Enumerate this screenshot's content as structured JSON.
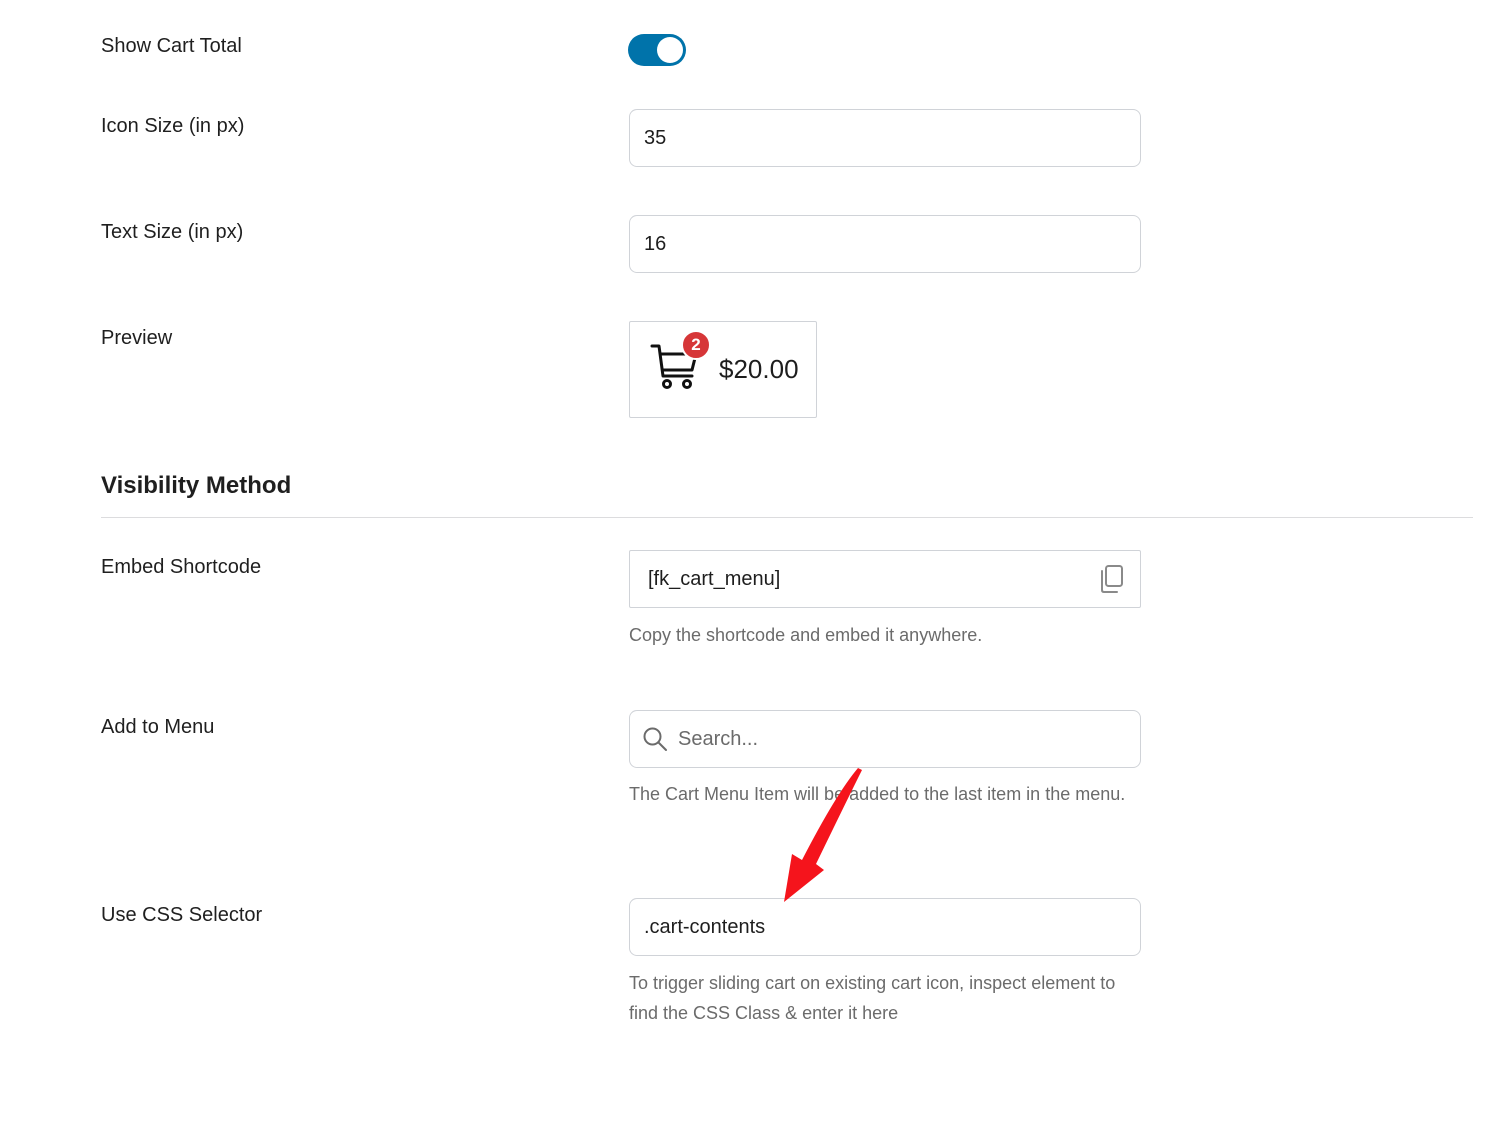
{
  "settings": {
    "show_cart_total": {
      "label": "Show Cart Total",
      "enabled": true
    },
    "icon_size": {
      "label": "Icon Size (in px)",
      "value": "35"
    },
    "text_size": {
      "label": "Text Size (in px)",
      "value": "16"
    },
    "preview": {
      "label": "Preview",
      "badge_count": "2",
      "total": "$20.00"
    }
  },
  "visibility": {
    "title": "Visibility Method",
    "embed_shortcode": {
      "label": "Embed Shortcode",
      "value": "[fk_cart_menu]",
      "help": "Copy the shortcode and embed it anywhere."
    },
    "add_to_menu": {
      "label": "Add to Menu",
      "placeholder": "Search...",
      "help": "The Cart Menu Item will be added to the last item in the menu."
    },
    "css_selector": {
      "label": "Use CSS Selector",
      "value": ".cart-contents",
      "help": "To trigger sliding cart on existing cart icon, inspect element to find the CSS Class & enter it here"
    }
  },
  "colors": {
    "toggle_on": "#0073aa",
    "badge": "#d63638",
    "annotation_arrow": "#f5141c"
  }
}
